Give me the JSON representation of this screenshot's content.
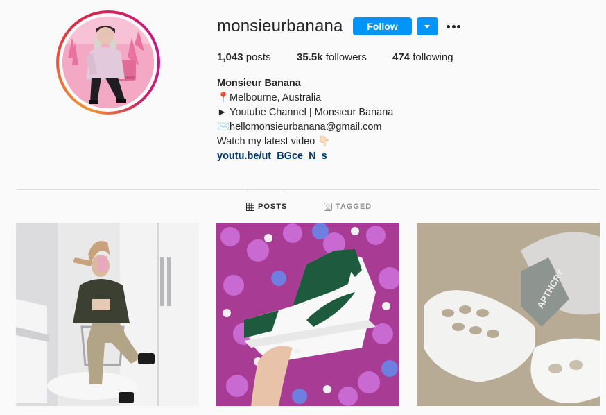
{
  "profile": {
    "username": "monsieurbanana",
    "follow_label": "Follow"
  },
  "stats": {
    "posts_count": "1,043",
    "posts_label": "posts",
    "followers_count": "35.5k",
    "followers_label": "followers",
    "following_count": "474",
    "following_label": "following"
  },
  "bio": {
    "name": "Monsieur Banana",
    "location": "📍Melbourne, Australia",
    "youtube": "► Youtube Channel | Monsieur Banana",
    "email": "✉️hellomonsieurbanana@gmail.com",
    "cta": "Watch my latest video 👇🏻",
    "link": "youtu.be/ut_BGce_N_s"
  },
  "tabs": {
    "posts": "POSTS",
    "tagged": "TAGGED"
  },
  "colors": {
    "follow_blue": "#0095f6",
    "link_blue": "#00376b",
    "text": "#262626",
    "muted": "#8e8e8e"
  },
  "icons": [
    "chevron-down-icon",
    "more-dots-icon",
    "grid-icon",
    "tagged-icon"
  ]
}
